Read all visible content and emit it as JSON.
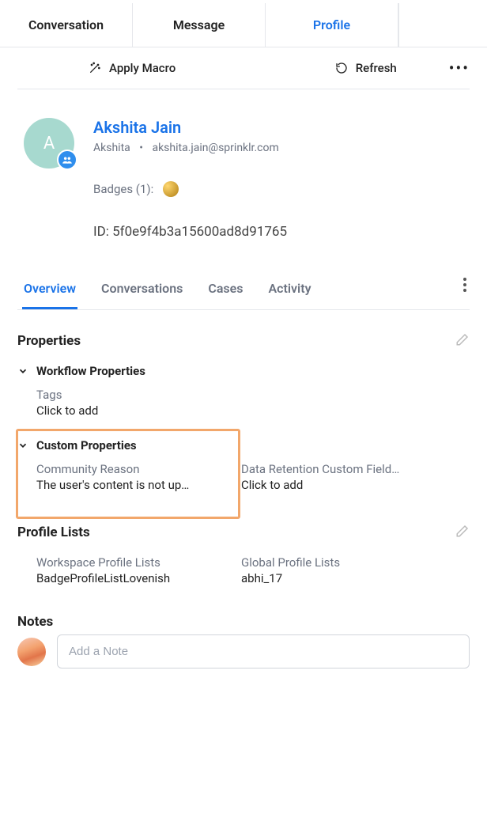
{
  "tabs": {
    "conversation": "Conversation",
    "message": "Message",
    "profile": "Profile"
  },
  "actions": {
    "apply_macro": "Apply Macro",
    "refresh": "Refresh"
  },
  "profile": {
    "initial": "A",
    "name": "Akshita Jain",
    "handle": "Akshita",
    "email": "akshita.jain@sprinklr.com",
    "badges_label": "Badges (1):",
    "id_label": "ID: 5f0e9f4b3a15600ad8d91765"
  },
  "subtabs": {
    "overview": "Overview",
    "conversations": "Conversations",
    "cases": "Cases",
    "activity": "Activity"
  },
  "sections": {
    "properties": {
      "title": "Properties",
      "workflow": {
        "title": "Workflow Properties",
        "tags_label": "Tags",
        "tags_value": "Click to add"
      },
      "custom": {
        "title": "Custom Properties",
        "community_reason_label": "Community Reason",
        "community_reason_value": "The user's content is not up…",
        "data_retention_label": "Data Retention Custom Field…",
        "data_retention_value": "Click to add"
      }
    },
    "profile_lists": {
      "title": "Profile Lists",
      "workspace_label": "Workspace Profile Lists",
      "workspace_value": "BadgeProfileListLovenish",
      "global_label": "Global Profile Lists",
      "global_value": "abhi_17"
    },
    "notes": {
      "title": "Notes",
      "placeholder": "Add a Note"
    }
  }
}
